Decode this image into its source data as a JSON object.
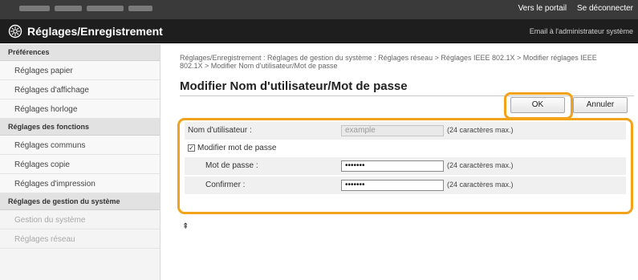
{
  "topbar": {
    "portal_link": "Vers le portail",
    "logout_link": "Se déconnecter"
  },
  "titlebar": {
    "title": "Réglages/Enregistrement",
    "email_link": "Email à l'administrateur système",
    "icon": "settings-gear-icon"
  },
  "sidebar": {
    "sections": [
      {
        "heading": "Préférences",
        "items": [
          "Réglages papier",
          "Réglages d'affichage",
          "Réglages horloge"
        ]
      },
      {
        "heading": "Réglages des fonctions",
        "items": [
          "Réglages communs",
          "Réglages copie",
          "Réglages d'impression"
        ]
      },
      {
        "heading": "Réglages de gestion du système",
        "items": [
          "Gestion du système",
          "Réglages réseau"
        ]
      }
    ]
  },
  "main": {
    "breadcrumb": "Réglages/Enregistrement : Réglages de gestion du système : Réglages réseau > Réglages IEEE 802.1X > Modifier réglages IEEE 802.1X > Modifier Nom d'utilisateur/Mot de passe",
    "title": "Modifier Nom d'utilisateur/Mot de passe",
    "ok_label": "OK",
    "cancel_label": "Annuler",
    "highlight_color": "#f3a319",
    "form": {
      "username_label": "Nom d'utilisateur :",
      "username_value": "example",
      "username_hint": "(24 caractères max.)",
      "change_password_label": "Modifier mot de passe",
      "change_password_checked": true,
      "password_label": "Mot de passe :",
      "password_value": "•••••••",
      "password_hint": "(24 caractères max.)",
      "confirm_label": "Confirmer :",
      "confirm_value": "•••••••",
      "confirm_hint": "(24 caractères max.)"
    },
    "top_arrow": "⇞"
  }
}
